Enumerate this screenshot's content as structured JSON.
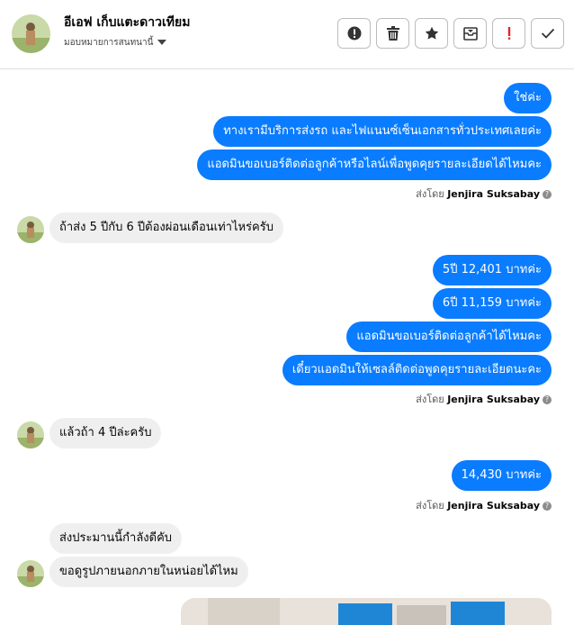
{
  "header": {
    "name": "อีเอฟ เก็บแตะดาวเทียม",
    "assign_label": "มอบหมายการสนทนานี้"
  },
  "actions": [
    "info-icon",
    "trash-icon",
    "star-icon",
    "archive-icon",
    "exclamation-icon",
    "check-icon"
  ],
  "colors": {
    "outgoing": "#0a7cff",
    "incoming": "#efefef",
    "accent_red": "#e4252e"
  },
  "messages": {
    "m1": "ใช่ค่ะ",
    "m2": "ทางเรามีบริการส่งรถ และไฟแนนซ์เซ็นเอกสารทั่วประเทศเลยค่ะ",
    "m3": "แอดมินขอเบอร์ติดต่อลูกค้าหรือไลน์เพื่อพูดคุยรายละเอียดได้ไหมคะ",
    "m4": "ถ้าส่ง 5 ปีกับ 6 ปีต้องผ่อนเดือนเท่าไหร่ครับ",
    "m5": "5ปี 12,401 บาทค่ะ",
    "m6": "6ปี 11,159 บาทค่ะ",
    "m7": "แอดมินขอเบอร์ติดต่อลูกค้าได้ไหมคะ",
    "m8": "เดี๋ยวแอดมินให้เซลล์ติดต่อพูดคุยรายละเอียดนะคะ",
    "m9": "แล้วถ้า 4 ปีล่ะครับ",
    "m10": "14,430 บาทค่ะ",
    "m11": "ส่งประมานนี้กำลังดีคับ",
    "m12": "ขอดูรูปภายนอกภายในหน่อยได้ไหม"
  },
  "sent_by": {
    "prefix": "ส่งโดย",
    "name": "Jenjira Suksabay"
  }
}
